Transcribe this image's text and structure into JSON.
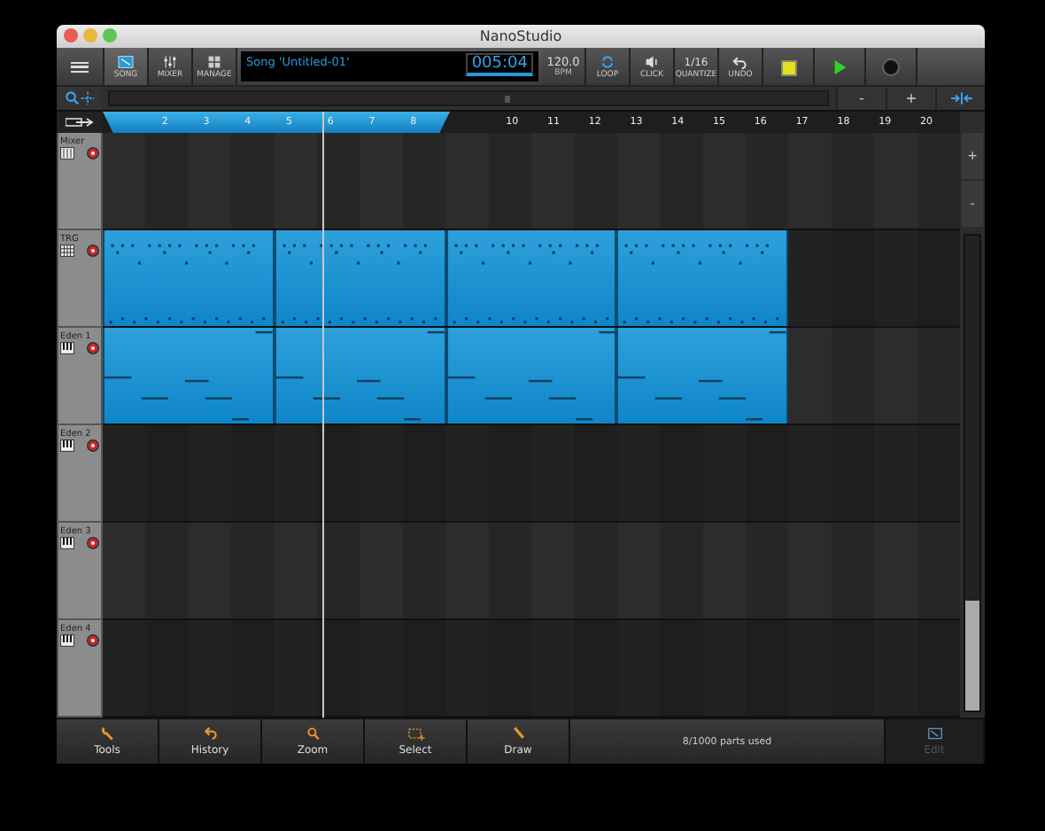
{
  "window": {
    "title": "NanoStudio"
  },
  "toolbar": {
    "buttons": [
      {
        "kind": "song",
        "label": "SONG",
        "selected": true
      },
      {
        "kind": "mixer",
        "label": "MIXER",
        "selected": false
      },
      {
        "kind": "manage",
        "label": "MANAGE",
        "selected": false
      }
    ],
    "song_name": "Song 'Untitled-01'",
    "time": "005:04",
    "tempo": "120.0",
    "tempo_unit": "BPM",
    "right_buttons": [
      {
        "kind": "loop",
        "label": "LOOP"
      },
      {
        "kind": "click",
        "label": "CLICK"
      },
      {
        "kind": "quantize",
        "value": "1/16",
        "label": "QUANTIZE"
      },
      {
        "kind": "undo",
        "label": "UNDO"
      }
    ],
    "transport": [
      {
        "kind": "stop"
      },
      {
        "kind": "play"
      },
      {
        "kind": "record"
      }
    ]
  },
  "zoom_row": {
    "buttons": [
      "-",
      "+"
    ]
  },
  "ruler": {
    "loop_labels": [
      "2",
      "3",
      "4",
      "5",
      "6",
      "7",
      "8"
    ],
    "labels_after": [
      "10",
      "11",
      "12",
      "13",
      "14",
      "15",
      "16",
      "17",
      "18",
      "19",
      "20"
    ]
  },
  "tracks": [
    {
      "name": "Mixer",
      "kind": "mixer",
      "armed": true
    },
    {
      "name": "TRG",
      "kind": "drums",
      "armed": true,
      "parts": [
        {
          "selected": true
        },
        {
          "selected": true
        },
        {
          "selected": true
        },
        {
          "selected": true
        }
      ]
    },
    {
      "name": "Eden 1",
      "kind": "synth",
      "armed": true,
      "parts": [
        {
          "selected": true
        },
        {
          "selected": true
        },
        {
          "selected": true
        },
        {
          "selected": true
        }
      ]
    },
    {
      "name": "Eden 2",
      "kind": "synth",
      "armed": true
    },
    {
      "name": "Eden 3",
      "kind": "synth",
      "armed": true
    },
    {
      "name": "Eden 4",
      "kind": "synth",
      "armed": true
    }
  ],
  "side_buttons": [
    "+",
    "-"
  ],
  "bottom_bar": {
    "tools": [
      {
        "kind": "tools",
        "label": "Tools"
      },
      {
        "kind": "history",
        "label": "History"
      },
      {
        "kind": "zoom",
        "label": "Zoom"
      },
      {
        "kind": "select",
        "label": "Select"
      },
      {
        "kind": "draw",
        "label": "Draw"
      }
    ],
    "status": "8/1000 parts used",
    "edit": {
      "label": "Edit",
      "disabled": true
    }
  }
}
